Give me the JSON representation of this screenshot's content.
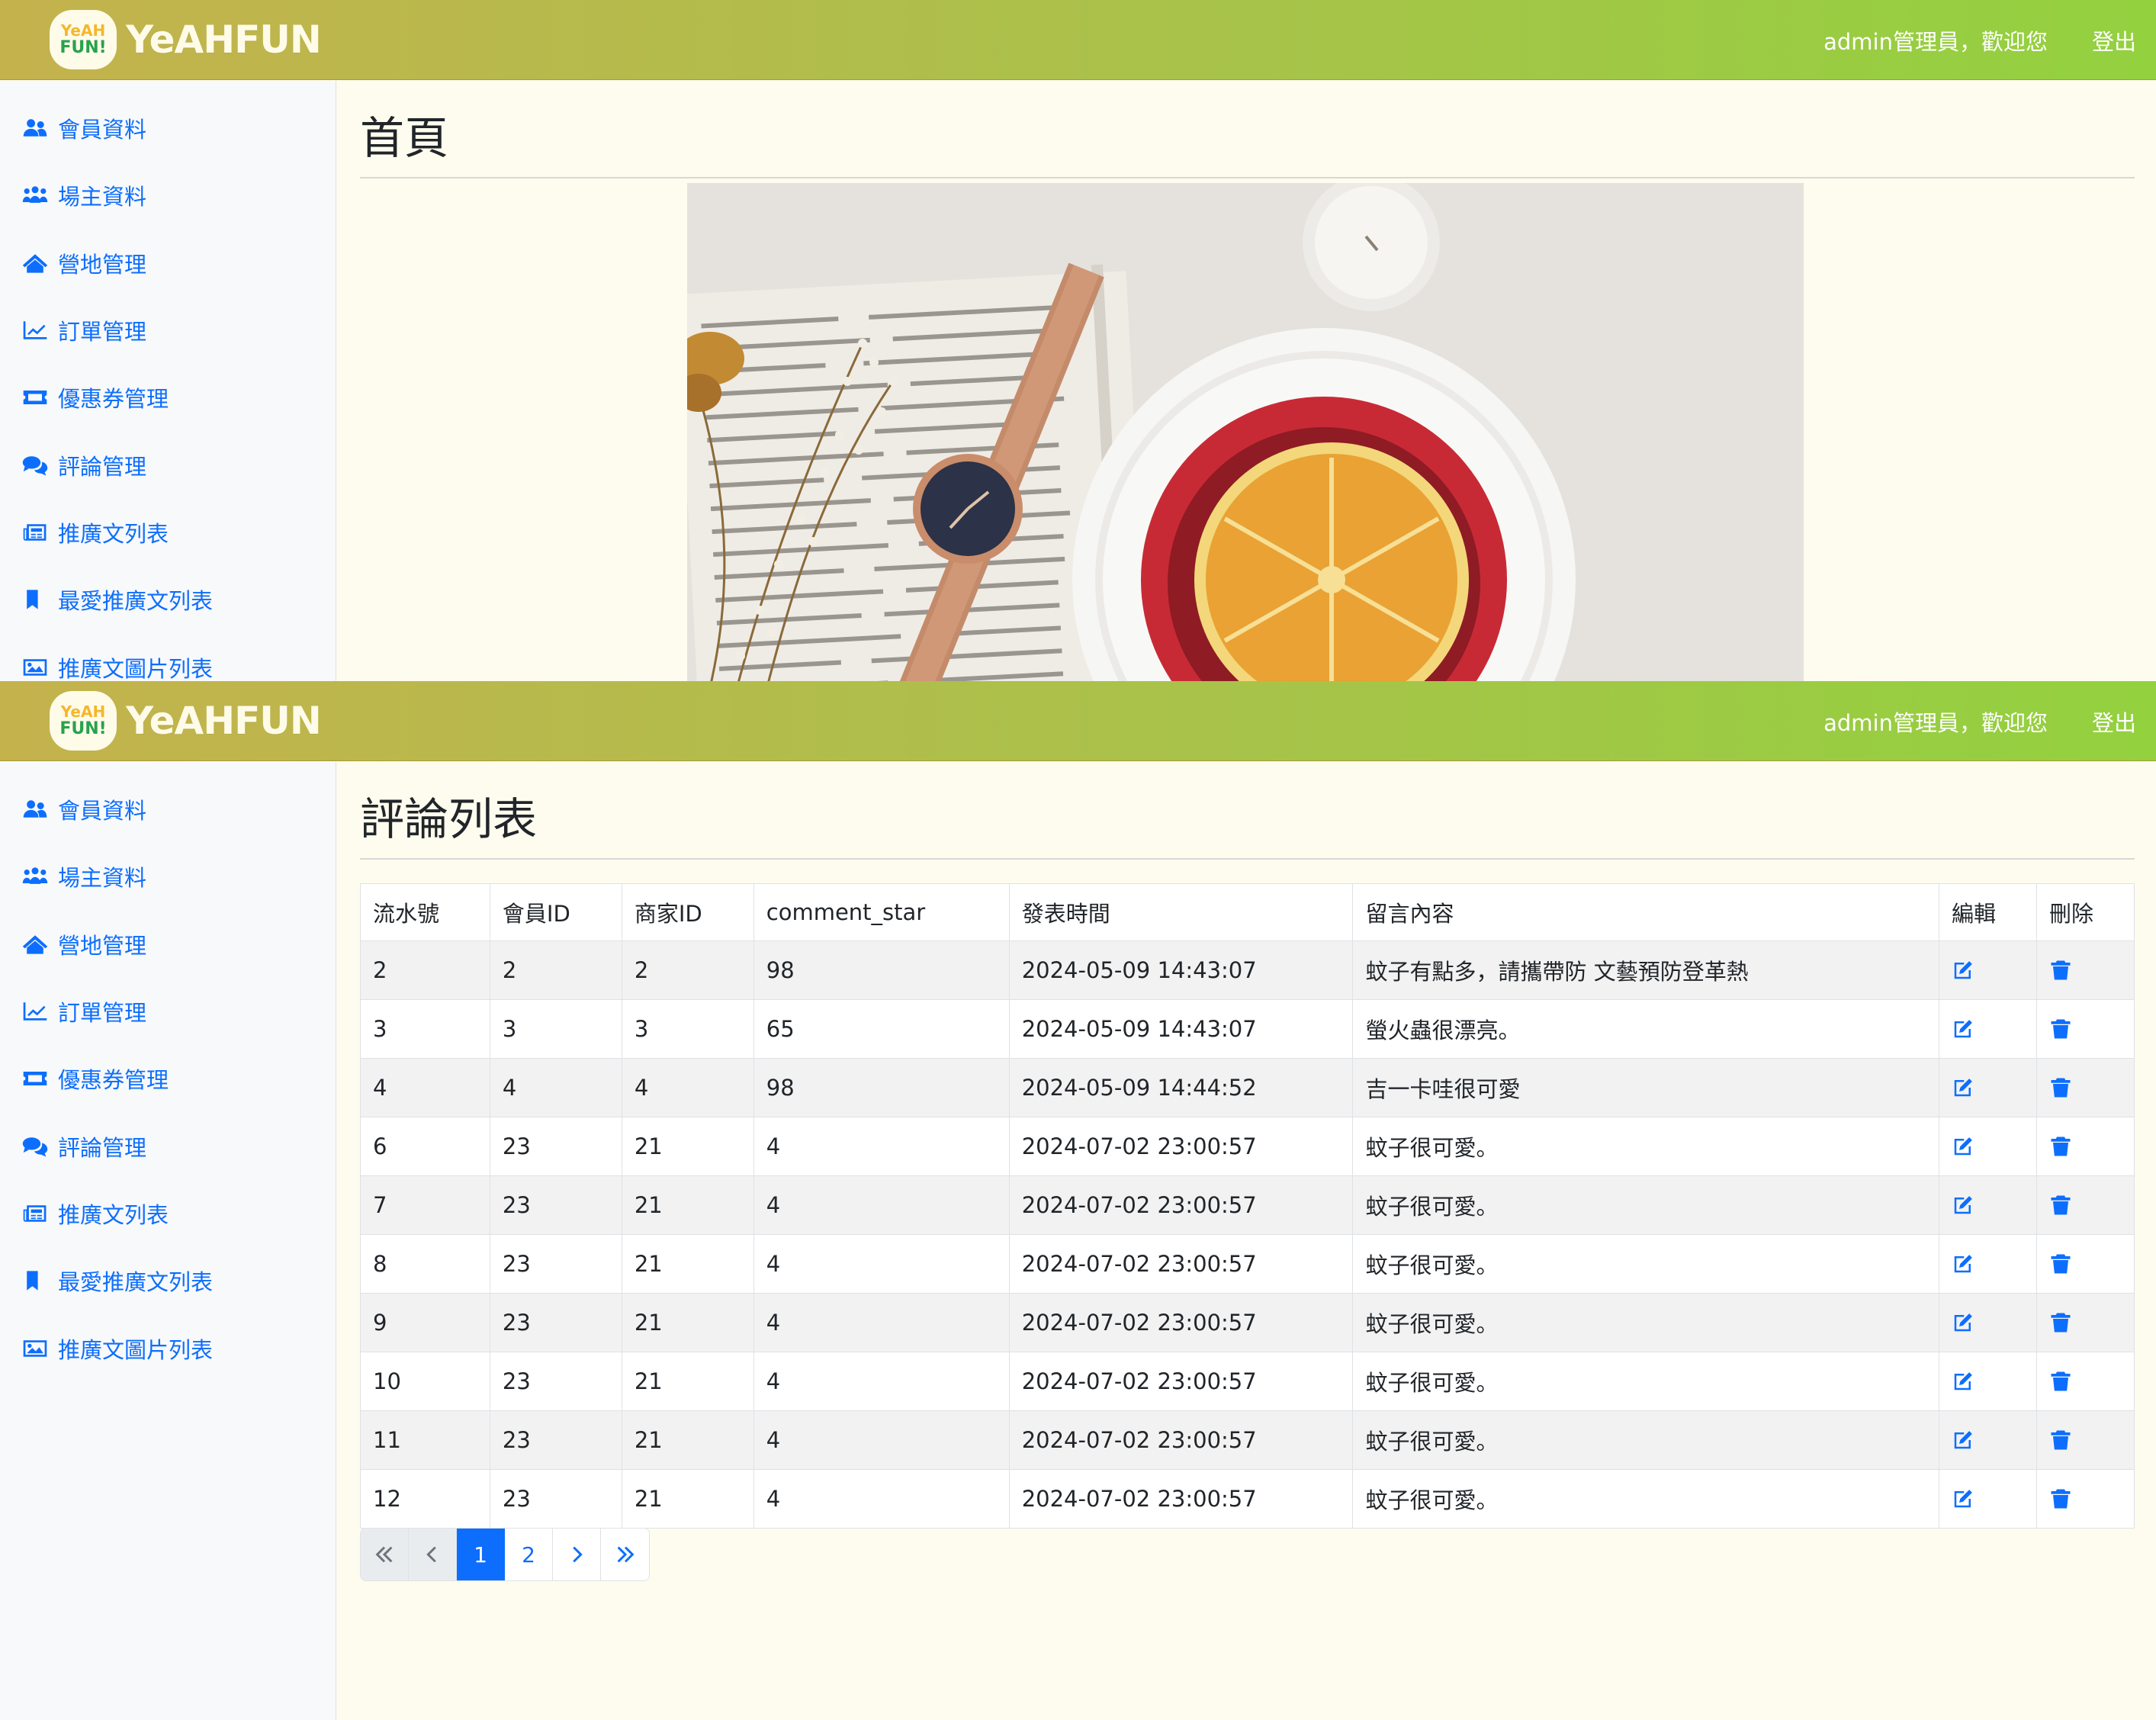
{
  "brand": {
    "logo_line1": "YeAH",
    "logo_line2": "FUN!",
    "name": "YeAHFUN"
  },
  "navbar": {
    "welcome": "admin管理員，歡迎您",
    "logout": "登出"
  },
  "sidebar": {
    "items": [
      {
        "label": "會員資料",
        "icon": "users-icon"
      },
      {
        "label": "場主資料",
        "icon": "group-icon"
      },
      {
        "label": "營地管理",
        "icon": "house-icon"
      },
      {
        "label": "訂單管理",
        "icon": "chart-line-icon"
      },
      {
        "label": "優惠券管理",
        "icon": "ticket-icon"
      },
      {
        "label": "評論管理",
        "icon": "comments-icon"
      },
      {
        "label": "推廣文列表",
        "icon": "newspaper-icon"
      },
      {
        "label": "最愛推廣文列表",
        "icon": "bookmark-icon"
      },
      {
        "label": "推廣文圖片列表",
        "icon": "image-icon"
      }
    ]
  },
  "home": {
    "title": "首頁"
  },
  "comments": {
    "title": "評論列表",
    "columns": [
      "流水號",
      "會員ID",
      "商家ID",
      "comment_star",
      "發表時間",
      "留言內容",
      "編輯",
      "刪除"
    ],
    "rows": [
      [
        "2",
        "2",
        "2",
        "98",
        "2024-05-09 14:43:07",
        "蚊子有點多，請攜帶防 文藝預防登革熱"
      ],
      [
        "3",
        "3",
        "3",
        "65",
        "2024-05-09 14:43:07",
        "螢火蟲很漂亮。"
      ],
      [
        "4",
        "4",
        "4",
        "98",
        "2024-05-09 14:44:52",
        "吉一卡哇很可愛"
      ],
      [
        "6",
        "23",
        "21",
        "4",
        "2024-07-02 23:00:57",
        "蚊子很可愛。"
      ],
      [
        "7",
        "23",
        "21",
        "4",
        "2024-07-02 23:00:57",
        "蚊子很可愛。"
      ],
      [
        "8",
        "23",
        "21",
        "4",
        "2024-07-02 23:00:57",
        "蚊子很可愛。"
      ],
      [
        "9",
        "23",
        "21",
        "4",
        "2024-07-02 23:00:57",
        "蚊子很可愛。"
      ],
      [
        "10",
        "23",
        "21",
        "4",
        "2024-07-02 23:00:57",
        "蚊子很可愛。"
      ],
      [
        "11",
        "23",
        "21",
        "4",
        "2024-07-02 23:00:57",
        "蚊子很可愛。"
      ],
      [
        "12",
        "23",
        "21",
        "4",
        "2024-07-02 23:00:57",
        "蚊子很可愛。"
      ]
    ],
    "edit_icon": "edit-icon",
    "delete_icon": "trash-icon"
  },
  "pagination": {
    "pages": [
      "1",
      "2"
    ],
    "current": "1"
  },
  "colors": {
    "accent": "#0d6efd",
    "navbar_start": "#c4b24d",
    "navbar_end": "#93d13f",
    "page_bg": "#fdfcee"
  }
}
